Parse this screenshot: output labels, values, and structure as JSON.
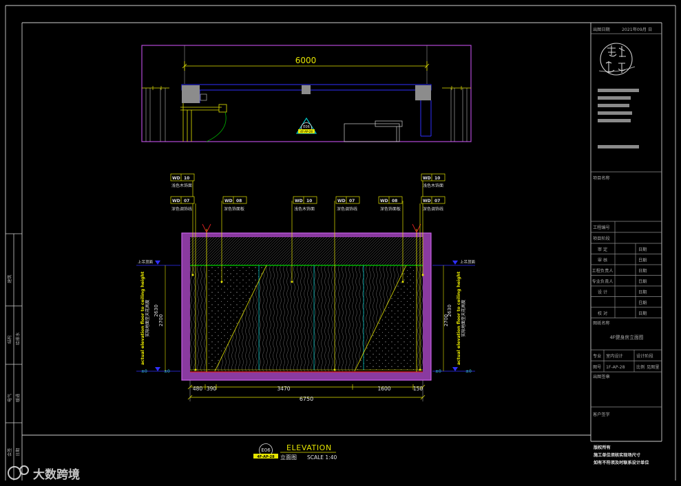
{
  "colors": {
    "background": "#000000",
    "frame": "#cfcfcf",
    "magenta": "#b54ad8",
    "yellow": "#e6e600",
    "blue": "#2f2fff",
    "cyan": "#00c4c4",
    "green": "#00b400",
    "red": "#e02020",
    "gray": "#8a8a8a"
  },
  "drawing": {
    "plan": {
      "width_dim": "6000",
      "marker_code": "E06",
      "marker_sheet": "4F-AP-28"
    },
    "labels": [
      {
        "code": "WD",
        "num": "10",
        "text": "浅色木饰面"
      },
      {
        "code": "WD",
        "num": "07",
        "text": "深色调饰线"
      },
      {
        "code": "WD",
        "num": "08",
        "text": "深色饰面板"
      },
      {
        "code": "WD",
        "num": "10",
        "text": "浅色木饰面"
      },
      {
        "code": "WD",
        "num": "07",
        "text": "深色调饰线"
      },
      {
        "code": "WD",
        "num": "08",
        "text": "深色饰面板"
      },
      {
        "code": "WD",
        "num": "10",
        "text": "浅色木饰面"
      },
      {
        "code": "WD",
        "num": "07",
        "text": "深色调饰线"
      }
    ],
    "left_side": {
      "level": "上吊顶面",
      "dim_a": "2630",
      "dim_b": "2700",
      "note_en": "actual elevation floor to ceiling height",
      "note_cn": "实际地面至天花高度",
      "floor": "±0"
    },
    "right_side": {
      "level": "上吊顶面",
      "dim_a": "2630",
      "dim_b": "2700",
      "note_en": "actual elevation floor to ceiling height",
      "note_cn": "实际地面至天花高度",
      "floor": "±0"
    },
    "bottom_dims": [
      "480",
      "390",
      "3470",
      "1600",
      "150"
    ],
    "total_dim": "6750",
    "title": {
      "code": "E06",
      "sheet": "4F-AP-28",
      "name_en": "ELEVATION",
      "name_cn": "立面图",
      "scale": "SCALE 1:40"
    }
  },
  "title_block": {
    "date_label": "出图日期",
    "date_value": "2021年09月   日",
    "logo_text": "书境设计",
    "project_name_label": "项目名称",
    "project_no_label": "工程编号",
    "project_stage_label": "项目阶段",
    "approvals": [
      {
        "role": "审  定",
        "date": "日期"
      },
      {
        "role": "审  核",
        "date": "日期"
      },
      {
        "role": "工程负责人",
        "date": "日期"
      },
      {
        "role": "专业负责人",
        "date": "日期"
      },
      {
        "role": "设  计",
        "date": "日期"
      },
      {
        "date": "日期"
      },
      {
        "role": "校  对",
        "date": "日期"
      }
    ],
    "drawing_name_label": "图纸名称",
    "drawing_name": "4F健身房立面图",
    "discipline_label": "专业",
    "discipline": "室内设计",
    "stage_label": "设计阶段",
    "sheet_label": "图号",
    "sheet_no": "1F-AP-28",
    "scale_label": "比例",
    "scale_value": "见图里",
    "seal_label": "出图签章",
    "client_label": "客户签字",
    "notes": [
      "版权所有",
      "施工单位须核实现场尺寸",
      "如有不符须及时联系设计单位"
    ]
  },
  "left_strip": [
    {
      "a": "建筑"
    },
    {
      "a": "结构",
      "b": "给排水"
    },
    {
      "a": "电气",
      "b": "暖通"
    },
    {
      "a": "会签",
      "b": "日期"
    }
  ],
  "watermark": "大数跨境"
}
